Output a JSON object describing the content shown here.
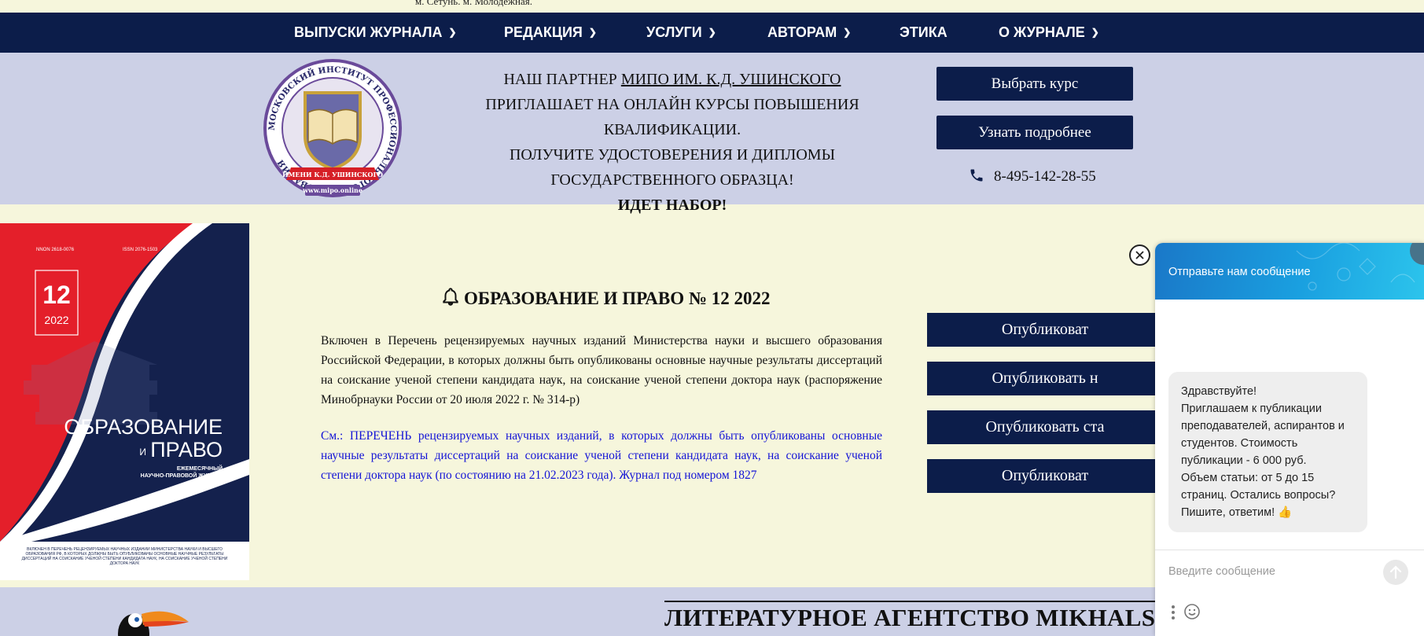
{
  "top_strip": {
    "text": "м. Сетунь. м. Молодежная."
  },
  "nav": {
    "items": [
      {
        "label": "ВЫПУСКИ ЖУРНАЛА",
        "dropdown": true
      },
      {
        "label": "РЕДАКЦИЯ",
        "dropdown": true
      },
      {
        "label": "УСЛУГИ",
        "dropdown": true
      },
      {
        "label": "АВТОРАМ",
        "dropdown": true
      },
      {
        "label": "ЭТИКА",
        "dropdown": false
      },
      {
        "label": "О ЖУРНАЛЕ",
        "dropdown": true
      }
    ]
  },
  "partner": {
    "prefix": "НАШ ПАРТНЕР ",
    "link": "МИПО ИМ. К.Д. УШИНСКОГО",
    "line2": "ПРИГЛАШАЕТ НА ОНЛАЙН КУРСЫ ПОВЫШЕНИЯ КВАЛИФИКАЦИИ.",
    "line3": "ПОЛУЧИТЕ УДОСТОВЕРЕНИЯ И ДИПЛОМЫ ГОСУДАРСТВЕННОГО ОБРАЗЦА!",
    "line4": "ИДЕТ НАБОР!",
    "btn_choose": "Выбрать курс",
    "btn_more": "Узнать подробнее",
    "phone": "8-495-142-28-55",
    "logo_ring": "МОСКОВСКИЙ ИНСТИТУТ ПРОФЕССИОНАЛЬНОГО ОБРАЗОВАНИЯ",
    "logo_ribbon": "ИМЕНИ К.Д. УШИНСКОГО",
    "logo_site": "www.mipo.online"
  },
  "cover": {
    "nnon": "NNON 2618-0076",
    "issn": "ISSN 2076-1503",
    "issue": "12",
    "year": "2022",
    "title1": "ОБРАЗОВАНИЕ",
    "title_and": "И",
    "title2": "ПРАВО",
    "sub1": "ЕЖЕМЕСЯЧНЫЙ",
    "sub2": "НАУЧНО-ПРАВОВОЙ ЖУРНАЛ",
    "footer": "ВКЛЮЧЕН В ПЕРЕЧЕНЬ РЕЦЕНЗИРУЕМЫХ НАУЧНЫХ ИЗДАНИЙ МИНИСТЕРСТВА НАУКИ И ВЫСШЕГО ОБРАЗОВАНИЯ РФ, В КОТОРЫХ ДОЛЖНЫ БЫТЬ ОПУБЛИКОВАНЫ ОСНОВНЫЕ НАУЧНЫЕ РЕЗУЛЬТАТЫ ДИССЕРТАЦИЙ НА СОИСКАНИЕ УЧЕНОЙ СТЕПЕНИ КАНДИДАТА НАУК, НА СОИСКАНИЕ УЧЕНОЙ СТЕПЕНИ ДОКТОРА НАУК"
  },
  "article": {
    "title": "ОБРАЗОВАНИЕ И ПРАВО № 12 2022",
    "p1": "Включен в Перечень рецензируемых научных изданий Министерства науки и высшего образования Российской Федерации, в которых должны быть опубликованы основные научные результаты диссертаций на соискание ученой степени кандидата наук, на соискание ученой степени доктора наук (распоряжение Минобрнауки России от 20 июля 2022 г. № 314-р)",
    "p2": "См.: ПЕРЕЧЕНЬ рецензируемых научных изданий, в которых должны быть опубликованы основные научные результаты диссертаций на соискание ученой степени кандидата наук, на соискание ученой степени доктора наук (по состоянию на 21.02.2023 года). Журнал под номером 1827"
  },
  "publish_buttons": [
    {
      "label": "Опубликоват"
    },
    {
      "label": "Опубликовать н"
    },
    {
      "label": "Опубликовать ста"
    },
    {
      "label": "Опубликоват"
    }
  ],
  "bottom": {
    "title": "ЛИТЕРАТУРНОЕ АГЕНТСТВО MIKHALSKY"
  },
  "chat": {
    "header": "Отправьте нам сообщение",
    "message": "Здравствуйте!\nПриглашаем к публикации преподавателей, аспирантов и студентов. Стоимость публикации - 6 000 руб.\nОбъем статьи: от 5 до 15 страниц. Остались вопросы? Пишите, ответим! 👍",
    "placeholder": "Введите сообщение"
  },
  "colors": {
    "navy": "#0c1d4a",
    "cream": "#f6f6dc",
    "lavender": "#ccd0e6",
    "link_blue": "#1414d6",
    "cover_red": "#e41f2a"
  }
}
